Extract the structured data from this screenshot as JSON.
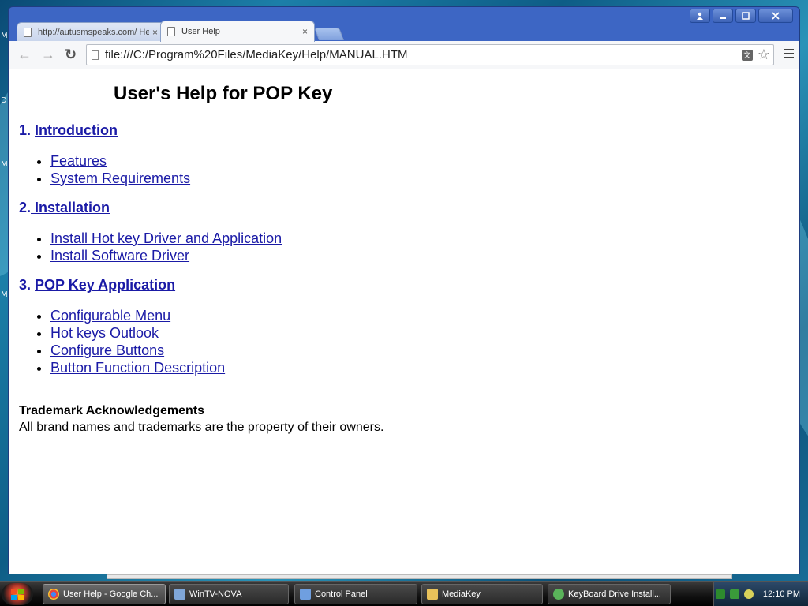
{
  "desktop": {
    "edge_letters": [
      "M",
      "D",
      "M",
      "M"
    ]
  },
  "window": {
    "controls": [
      "user-icon",
      "minimize-icon",
      "maximize-icon",
      "close-icon"
    ]
  },
  "tabs": [
    {
      "title": "http://autusmspeaks.com/ He",
      "close": "×"
    },
    {
      "title": "User Help",
      "close": "×"
    }
  ],
  "toolbar": {
    "back": "←",
    "forward": "→",
    "reload": "↻",
    "url": "file:///C:/Program%20Files/MediaKey/Help/MANUAL.HTM",
    "translate": "文",
    "star": "☆"
  },
  "page": {
    "title": "User's Help for POP Key",
    "sections": [
      {
        "number": "1.",
        "heading": "Introduction",
        "items": [
          "Features",
          "System Requirements"
        ]
      },
      {
        "number": "2.",
        "heading": " Installation",
        "items": [
          "Install Hot key Driver and Application",
          "Install Software Driver"
        ]
      },
      {
        "number": "3.",
        "heading": "POP Key Application",
        "items": [
          "Configurable Menu",
          "Hot keys Outlook",
          "Configure Buttons",
          "Button Function Description"
        ]
      }
    ],
    "trademark_heading": "Trademark Acknowledgements",
    "trademark_text": "All brand names and trademarks are the property of their owners."
  },
  "taskbar": {
    "tasks": [
      {
        "label": "User Help - Google Ch...",
        "icon": "chrome-icon",
        "color": "#e8453c"
      },
      {
        "label": "WinTV-NOVA",
        "icon": "tv-icon",
        "color": "#7fa6d8"
      },
      {
        "label": "Control Panel",
        "icon": "control-panel-icon",
        "color": "#6f9fe0"
      },
      {
        "label": "MediaKey",
        "icon": "folder-icon",
        "color": "#e9c25a"
      },
      {
        "label": "KeyBoard Drive Install...",
        "icon": "installer-icon",
        "color": "#5ab35a"
      }
    ],
    "time": "12:10 PM"
  },
  "colors": {
    "link": "#1a1aa6",
    "window_frame": "#3d66c4",
    "taskbar": "#111111"
  }
}
